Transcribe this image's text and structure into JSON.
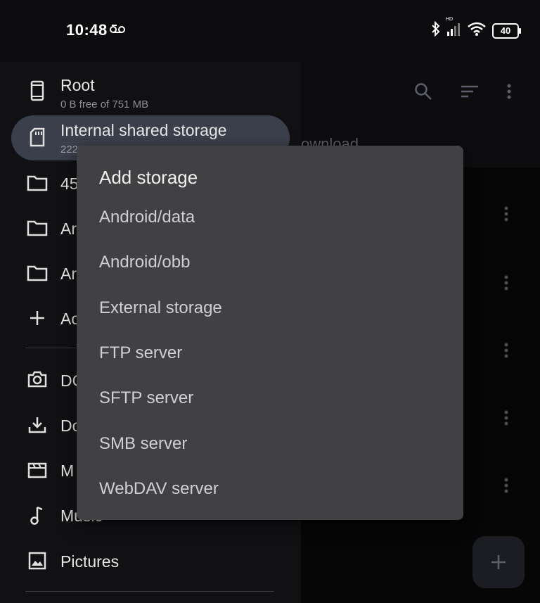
{
  "status_bar": {
    "time": "10:48",
    "battery": "40",
    "signal_tag": "HD"
  },
  "main": {
    "breadcrumb": "ownload"
  },
  "drawer": {
    "root": {
      "label": "Root",
      "sub": "0 B free of 751 MB",
      "icon": "phone-icon"
    },
    "internal": {
      "label": "Internal shared storage",
      "sub": "222",
      "icon": "sd-card-icon"
    },
    "items": [
      {
        "label": "45",
        "icon": "folder-icon"
      },
      {
        "label": "Ar",
        "icon": "folder-icon"
      },
      {
        "label": "Ar",
        "icon": "folder-icon"
      },
      {
        "label": "Ac",
        "icon": "plus-icon"
      },
      {
        "label": "DC",
        "icon": "camera-icon"
      },
      {
        "label": "Do",
        "icon": "download-icon"
      },
      {
        "label": "M",
        "icon": "movies-icon"
      },
      {
        "label": "Music",
        "icon": "music-icon"
      },
      {
        "label": "Pictures",
        "icon": "image-icon"
      }
    ]
  },
  "dialog": {
    "title": "Add storage",
    "options": [
      "Android/data",
      "Android/obb",
      "External storage",
      "FTP server",
      "SFTP server",
      "SMB server",
      "WebDAV server"
    ]
  },
  "colors": {
    "dialog_bg": "#414144",
    "selected_bg": "#3b3f4b",
    "drawer_bg": "#111114"
  }
}
